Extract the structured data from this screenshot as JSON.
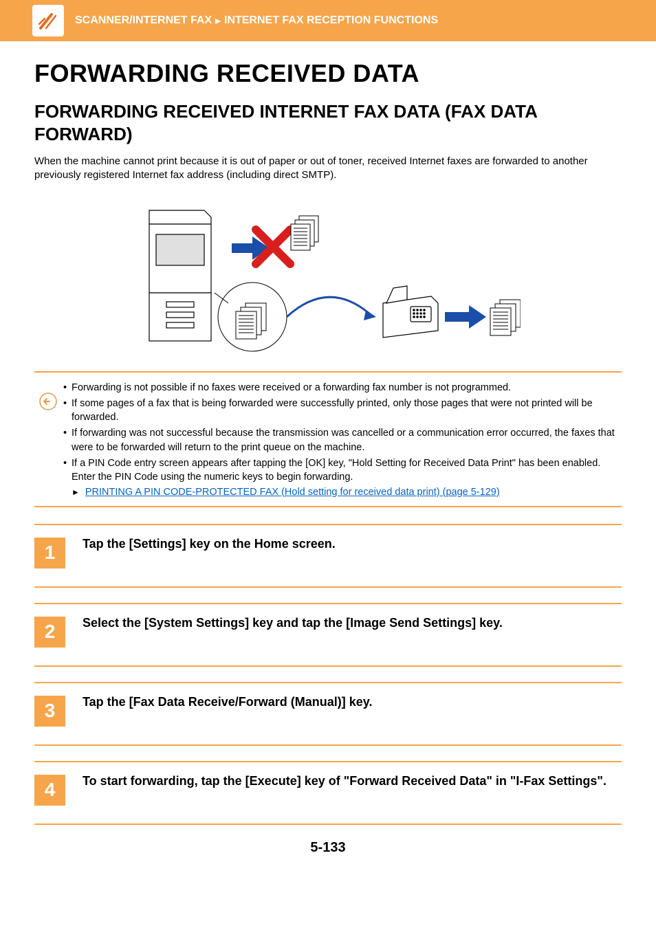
{
  "header": {
    "breadcrumb_left": "SCANNER/INTERNET FAX",
    "breadcrumb_right": "INTERNET FAX RECEPTION FUNCTIONS"
  },
  "title": "FORWARDING RECEIVED DATA",
  "subtitle": "FORWARDING RECEIVED INTERNET FAX DATA (FAX DATA FORWARD)",
  "intro": "When the machine cannot print because it is out of paper or out of toner, received Internet faxes are forwarded to another previously registered Internet fax address (including direct SMTP).",
  "bullets": [
    "Forwarding is not possible if no faxes were received or a forwarding fax number is not programmed.",
    "If some pages of a fax that is being forwarded were successfully printed, only those pages that were not printed will be forwarded.",
    "If forwarding was not successful because the transmission was cancelled or a communication error occurred, the faxes that were to be forwarded will return to the print queue on the machine.",
    "If a PIN Code entry screen appears after tapping the [OK] key, \"Hold Setting for Received Data Print\" has been enabled. Enter the PIN Code using the numeric keys to begin forwarding."
  ],
  "cross_ref": "PRINTING A PIN CODE-PROTECTED FAX (Hold setting for received data print) (page 5-129)",
  "steps": [
    {
      "n": "1",
      "text": "Tap the [Settings] key on the Home screen."
    },
    {
      "n": "2",
      "text": "Select the [System Settings] key and tap the [Image Send Settings] key."
    },
    {
      "n": "3",
      "text": "Tap the [Fax Data Receive/Forward (Manual)] key."
    },
    {
      "n": "4",
      "text": "To start forwarding, tap the [Execute] key of \"Forward Received Data\" in \"I-Fax Settings\"."
    }
  ],
  "page_number": "5-133"
}
